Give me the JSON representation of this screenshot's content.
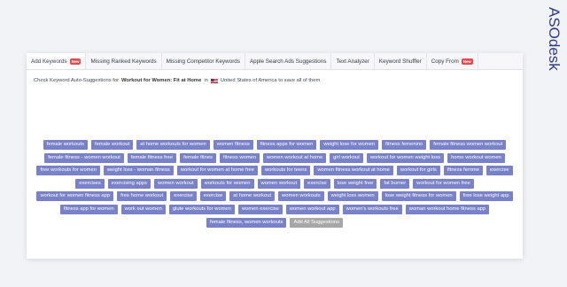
{
  "brand": {
    "logo_text": "ASOdesk"
  },
  "tabs": [
    {
      "label": "Add Keywords",
      "badge": "New",
      "active": true
    },
    {
      "label": "Missing Ranked Keywords"
    },
    {
      "label": "Missing Competitor Keywords"
    },
    {
      "label": "Apple Search Ads Suggestions"
    },
    {
      "label": "Text Analyzer"
    },
    {
      "label": "Keyword Shuffler"
    },
    {
      "label": "Copy From",
      "badge": "New"
    }
  ],
  "info": {
    "prefix": "Check Keyword Auto-Suggestions for",
    "query": "Workout for Women: Fit at Home",
    "in": "in",
    "country": "United States of America to save all of them",
    "flag_icon": "us-flag-icon"
  },
  "suggestions": [
    "female workouts",
    "female workout",
    "at home workouts for women",
    "women fitness",
    "fitness apps for women",
    "weight lose for women",
    "fitness femenino",
    "female fitness women workout",
    "female fitness - women workout",
    "female fitness free",
    "female fitnes",
    "fitness women",
    "women workout at home",
    "girl workout",
    "workout for women weight loss",
    "home workout women",
    "free workouts for women",
    "weight loss - woman fitness",
    "workout for women at home free",
    "workouts for teens",
    "women fitness workout at home",
    "workout for girls",
    "fitness femme",
    "exercise",
    "exercises",
    "exercising apps",
    "women workout",
    "workouts for women",
    "women workout",
    "exercise",
    "lose weight free",
    "fat burner",
    "workout for women free",
    "workout for women fitness app",
    "free home workout",
    "exercise",
    "exercise",
    "at home workout",
    "women workouts",
    "weight loss women",
    "lose weight fitness for women",
    "free lose weight app",
    "fitness app for women",
    "work out women",
    "glute workouts for women",
    "women exercise",
    "women workout app",
    "women's workouts free",
    "woman workout home fitness app",
    "female fitness, women workouts"
  ],
  "add_all_label": "Add All Suggestions",
  "colors": {
    "chip": "#7982c9",
    "add_all": "#a7a7a7",
    "badge": "#e5484d",
    "brand": "#2e3a8c"
  }
}
